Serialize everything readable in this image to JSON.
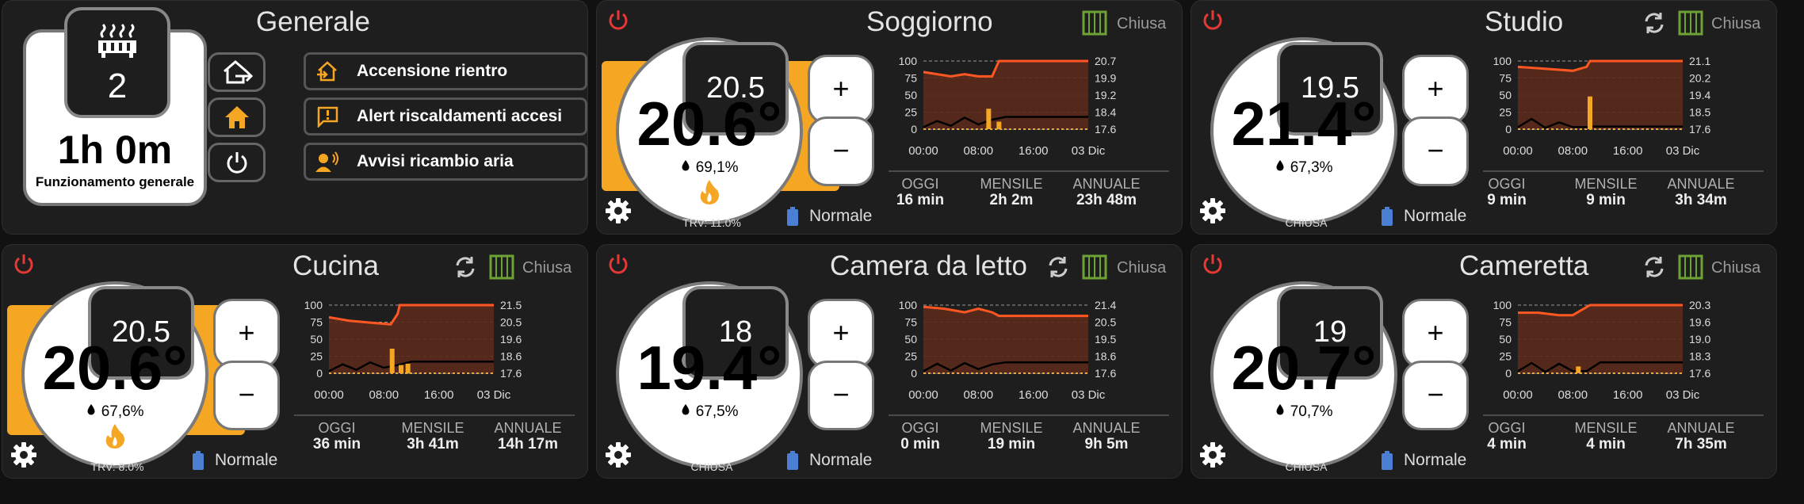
{
  "colors": {
    "accent": "#f5a623",
    "flame": "#f5a623",
    "power": "#e53935",
    "window": "#6ea234",
    "chart_line": "#ff5722",
    "chart_fill": "#5a2a1c",
    "panel": "#1e1e1e"
  },
  "generale": {
    "title": "Generale",
    "device_count": "2",
    "runtime": "1h 0m",
    "runtime_label": "Funzionamento generale",
    "icons": [
      "home-export-icon",
      "home-icon",
      "power-icon"
    ],
    "actions": [
      {
        "label": "Accensione rientro",
        "icon": "home-import-icon"
      },
      {
        "label": "Alert riscaldamenti accesi",
        "icon": "message-alert-icon"
      },
      {
        "label": "Avvisi ricambio aria",
        "icon": "account-voice-icon"
      }
    ]
  },
  "rooms": [
    {
      "name": "Soggiorno",
      "setpoint": "20.5",
      "temp": "20.6°",
      "humidity": "69,1%",
      "heating": true,
      "state_label": "TRV: 11.0%",
      "window": "Chiusa",
      "show_sync": false,
      "mode": "Normale",
      "stats": {
        "oggi": {
          "label": "OGGI",
          "value": "16 min"
        },
        "mensile": {
          "label": "MENSILE",
          "value": "2h 2m"
        },
        "annuale": {
          "label": "ANNUALE",
          "value": "23h 48m"
        }
      },
      "chart_data": {
        "type": "line",
        "x_ticks": [
          "00:00",
          "08:00",
          "16:00",
          "03 Dic"
        ],
        "left_axis": {
          "ticks": [
            "100",
            "75",
            "50",
            "25",
            "0"
          ],
          "ylim": [
            0,
            100
          ]
        },
        "right_axis": {
          "ticks": [
            "20.7",
            "19.9",
            "19.2",
            "18.4",
            "17.6"
          ]
        },
        "temperature": [
          [
            0,
            20.2
          ],
          [
            2,
            20.1
          ],
          [
            4,
            20.0
          ],
          [
            6,
            20.1
          ],
          [
            8,
            20.0
          ],
          [
            10,
            20.0
          ],
          [
            11,
            20.7
          ],
          [
            24,
            20.7
          ]
        ],
        "humidity": [
          [
            0,
            3
          ],
          [
            2,
            12
          ],
          [
            4,
            5
          ],
          [
            6,
            17
          ],
          [
            8,
            7
          ],
          [
            10,
            14
          ],
          [
            12,
            18
          ],
          [
            24,
            18
          ]
        ],
        "valve": [
          [
            9.5,
            30
          ],
          [
            11,
            11
          ]
        ]
      }
    },
    {
      "name": "Studio",
      "setpoint": "19.5",
      "temp": "21.4°",
      "humidity": "67,3%",
      "heating": false,
      "state_label": "CHIUSA",
      "window": "Chiusa",
      "show_sync": true,
      "mode": "Normale",
      "stats": {
        "oggi": {
          "label": "OGGI",
          "value": "9 min"
        },
        "mensile": {
          "label": "MENSILE",
          "value": "9 min"
        },
        "annuale": {
          "label": "ANNUALE",
          "value": "3h 34m"
        }
      },
      "chart_data": {
        "type": "line",
        "x_ticks": [
          "00:00",
          "08:00",
          "16:00",
          "03 Dic"
        ],
        "left_axis": {
          "ticks": [
            "100",
            "75",
            "50",
            "25",
            "0"
          ],
          "ylim": [
            0,
            100
          ]
        },
        "right_axis": {
          "ticks": [
            "21.1",
            "20.2",
            "19.4",
            "18.5",
            "17.6"
          ]
        },
        "temperature": [
          [
            0,
            20.8
          ],
          [
            4,
            20.7
          ],
          [
            8,
            20.6
          ],
          [
            10,
            20.8
          ],
          [
            10.5,
            21.1
          ],
          [
            24,
            21.1
          ]
        ],
        "humidity": [
          [
            0,
            3
          ],
          [
            2,
            15
          ],
          [
            4,
            2
          ],
          [
            6,
            10
          ],
          [
            8,
            3
          ],
          [
            10,
            3
          ],
          [
            11,
            4
          ],
          [
            24,
            4
          ]
        ],
        "valve": [
          [
            10.5,
            48
          ]
        ]
      }
    },
    {
      "name": "Cucina",
      "setpoint": "20.5",
      "temp": "20.6°",
      "humidity": "67,6%",
      "heating": true,
      "state_label": "TRV: 8.0%",
      "window": "Chiusa",
      "show_sync": true,
      "mode": "Normale",
      "stats": {
        "oggi": {
          "label": "OGGI",
          "value": "36 min"
        },
        "mensile": {
          "label": "MENSILE",
          "value": "3h 41m"
        },
        "annuale": {
          "label": "ANNUALE",
          "value": "14h 17m"
        }
      },
      "chart_data": {
        "type": "line",
        "x_ticks": [
          "00:00",
          "08:00",
          "16:00",
          "03 Dic"
        ],
        "left_axis": {
          "ticks": [
            "100",
            "75",
            "50",
            "25",
            "0"
          ],
          "ylim": [
            0,
            100
          ]
        },
        "right_axis": {
          "ticks": [
            "21.5",
            "20.5",
            "19.6",
            "18.6",
            "17.6"
          ]
        },
        "temperature": [
          [
            0,
            20.8
          ],
          [
            3,
            20.6
          ],
          [
            6,
            20.5
          ],
          [
            9,
            20.4
          ],
          [
            10,
            21.0
          ],
          [
            10.3,
            21.5
          ],
          [
            24,
            21.5
          ]
        ],
        "humidity": [
          [
            0,
            3
          ],
          [
            2,
            13
          ],
          [
            4,
            5
          ],
          [
            6,
            16
          ],
          [
            8,
            8
          ],
          [
            10,
            12
          ],
          [
            12,
            17
          ],
          [
            24,
            17
          ]
        ],
        "valve": [
          [
            9.2,
            36
          ],
          [
            10.5,
            12
          ],
          [
            11.5,
            14
          ]
        ]
      }
    },
    {
      "name": "Camera da letto",
      "setpoint": "18",
      "temp": "19.4°",
      "humidity": "67,5%",
      "heating": false,
      "state_label": "CHIUSA",
      "window": "Chiusa",
      "show_sync": true,
      "mode": "Normale",
      "stats": {
        "oggi": {
          "label": "OGGI",
          "value": "0 min"
        },
        "mensile": {
          "label": "MENSILE",
          "value": "19 min"
        },
        "annuale": {
          "label": "ANNUALE",
          "value": "9h 5m"
        }
      },
      "chart_data": {
        "type": "line",
        "x_ticks": [
          "00:00",
          "08:00",
          "16:00",
          "03 Dic"
        ],
        "left_axis": {
          "ticks": [
            "100",
            "75",
            "50",
            "25",
            "0"
          ],
          "ylim": [
            0,
            100
          ]
        },
        "right_axis": {
          "ticks": [
            "21.4",
            "20.5",
            "19.5",
            "18.6",
            "17.6"
          ]
        },
        "temperature": [
          [
            0,
            21.3
          ],
          [
            3,
            21.2
          ],
          [
            6,
            21.0
          ],
          [
            8,
            21.2
          ],
          [
            10,
            21.0
          ],
          [
            11,
            20.8
          ],
          [
            24,
            20.8
          ]
        ],
        "humidity": [
          [
            0,
            3
          ],
          [
            2,
            14
          ],
          [
            4,
            4
          ],
          [
            6,
            15
          ],
          [
            8,
            6
          ],
          [
            10,
            13
          ],
          [
            12,
            16
          ],
          [
            24,
            16
          ]
        ],
        "valve": []
      }
    },
    {
      "name": "Cameretta",
      "setpoint": "19",
      "temp": "20.7°",
      "humidity": "70,7%",
      "heating": false,
      "state_label": "CHIUSA",
      "window": "Chiusa",
      "show_sync": true,
      "mode": "Normale",
      "stats": {
        "oggi": {
          "label": "OGGI",
          "value": "4 min"
        },
        "mensile": {
          "label": "MENSILE",
          "value": "4 min"
        },
        "annuale": {
          "label": "ANNUALE",
          "value": "7h 35m"
        }
      },
      "chart_data": {
        "type": "line",
        "x_ticks": [
          "00:00",
          "08:00",
          "16:00",
          "03 Dic"
        ],
        "left_axis": {
          "ticks": [
            "100",
            "75",
            "50",
            "25",
            "0"
          ],
          "ylim": [
            0,
            100
          ]
        },
        "right_axis": {
          "ticks": [
            "20.3",
            "19.6",
            "19.0",
            "18.3",
            "17.6"
          ]
        },
        "temperature": [
          [
            0,
            20.0
          ],
          [
            3,
            20.0
          ],
          [
            6,
            19.9
          ],
          [
            8,
            19.9
          ],
          [
            10.5,
            20.3
          ],
          [
            24,
            20.3
          ]
        ],
        "humidity": [
          [
            0,
            3
          ],
          [
            2,
            15
          ],
          [
            4,
            2
          ],
          [
            6,
            14
          ],
          [
            8,
            3
          ],
          [
            10,
            3
          ],
          [
            12,
            16
          ],
          [
            24,
            16
          ]
        ],
        "valve": [
          [
            8.8,
            10
          ]
        ]
      }
    }
  ]
}
